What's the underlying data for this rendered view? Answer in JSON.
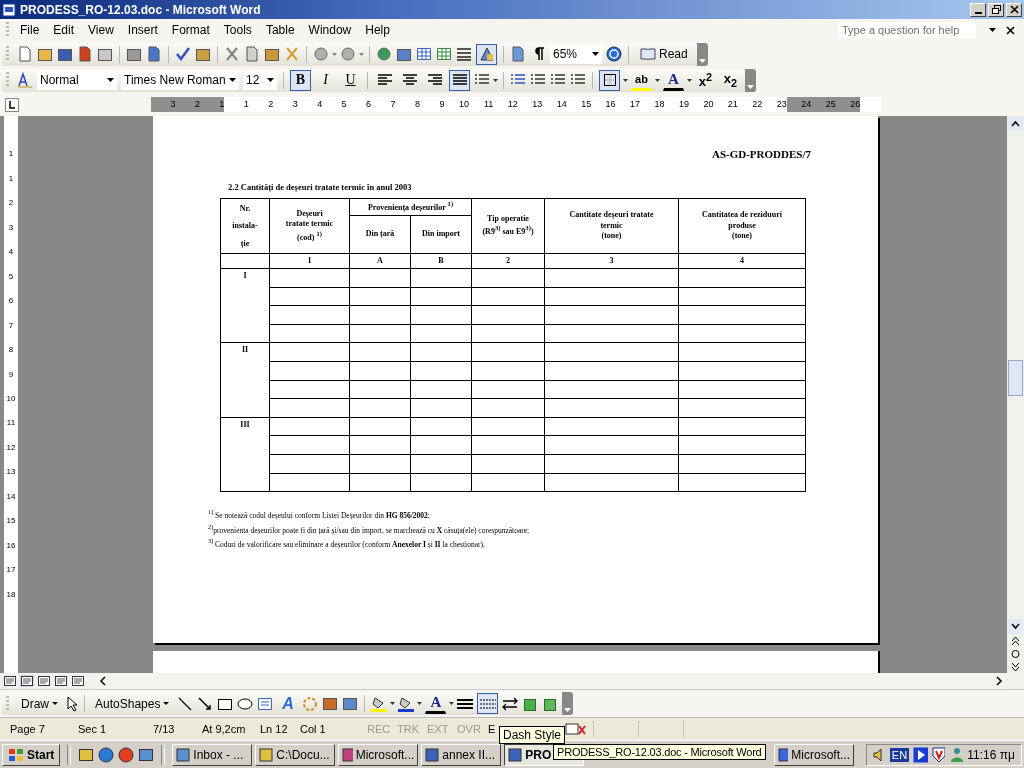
{
  "window": {
    "title": "PRODESS_RO-12.03.doc - Microsoft Word"
  },
  "menu": {
    "items": [
      "File",
      "Edit",
      "View",
      "Insert",
      "Format",
      "Tools",
      "Table",
      "Window",
      "Help"
    ],
    "help_box": {
      "placeholder": "Type a question for help"
    }
  },
  "standard_toolbar": {
    "drawing_selected": true,
    "zoom": "65%",
    "read": "Read"
  },
  "formatting_toolbar": {
    "style": "Normal",
    "font": "Times New Roman",
    "size": "12",
    "text_buttons": [
      {
        "label": "B",
        "selected": true
      },
      {
        "label": "I",
        "selected": false
      },
      {
        "label": "U",
        "selected": false
      }
    ],
    "alignments": [
      {
        "selected": false
      },
      {
        "selected": false
      },
      {
        "selected": false
      },
      {
        "selected": true
      }
    ],
    "highlight": "ab",
    "font_color": "A",
    "superscript": "x$^{2}$",
    "subscript": "x$_{2}$"
  },
  "ruler": {
    "numbers": [
      "3",
      "2",
      "1",
      "1",
      "2",
      "3",
      "4",
      "5",
      "6",
      "7",
      "8",
      "9",
      "10",
      "11",
      "12",
      "13",
      "14",
      "15",
      "16",
      "17",
      "18",
      "19",
      "20",
      "21",
      "22",
      "23",
      "24",
      "25",
      "26"
    ]
  },
  "vertical_ruler": {
    "numbers": [
      "1",
      "1",
      "2",
      "3",
      "4",
      "5",
      "6",
      "7",
      "8",
      "9",
      "10",
      "11",
      "12",
      "13",
      "14",
      "15",
      "16",
      "17",
      "18"
    ]
  },
  "document": {
    "header_code": "AS-GD-PRODDES/7",
    "section_title": "2.2 Cantități de deșeuri tratate termic în anul 2003",
    "table": {
      "col_nr": "Nr.\ninstala-\nție",
      "col_waste": "Deșeuri\ntratate termic\n(cod) $^{1)}$",
      "col_origin": "Proveniența deșeurilor $^{1)}$",
      "col_domestic": "Din țară",
      "col_import": "Din import",
      "col_operation": "Tip operatie\n(R9$^{3)}$ sau E9$^{3)}$)",
      "col_quantity": "Cantitate deșeuri tratate\ntermic\n(tone)",
      "col_residues": "Cantitatea de reziduuri\nproduse\n(tone)",
      "column_numbers": [
        "1",
        "A",
        "B",
        "2",
        "3",
        "4"
      ],
      "groups": [
        "I",
        "II",
        "III"
      ]
    },
    "footnotes": [
      "$^{1)}$ Se notează codul deșeului conform Listei Deșeurilor din **HG 856/2002**;",
      "$^{2)}$provenienta deșeurilor poate fi din țară și/sau din import, se marchează cu **X** căsuța(ele) corespunzătoare;",
      "$^{3)}$ Coduri de valorificare sau eliminare a deșeurilor (conform **Anexelor I** și **II** la chestionar)."
    ]
  },
  "drawing_toolbar": {
    "draw": "Draw",
    "autoshapes": "AutoShapes",
    "wordart": "A",
    "font_color": "A",
    "dash_style_selected": true
  },
  "status_bar": {
    "items": [
      {
        "text": "Page 7",
        "disabled": false
      },
      {
        "text": "Sec 1",
        "disabled": false
      },
      {
        "text": "7/13",
        "disabled": false
      },
      {
        "text": "At 9,2cm",
        "disabled": false
      },
      {
        "text": "Ln 12",
        "disabled": false
      },
      {
        "text": "Col 1",
        "disabled": false
      },
      {
        "text": "REC",
        "disabled": true
      },
      {
        "text": "TRK",
        "disabled": true
      },
      {
        "text": "EXT",
        "disabled": true
      },
      {
        "text": "OVR",
        "disabled": true
      },
      {
        "text": "E",
        "disabled": false
      }
    ],
    "tooltip": "Dash Style"
  },
  "taskbar": {
    "start": "Start",
    "tasks": [
      {
        "label": "Inbox - ...",
        "selected": false
      },
      {
        "label": "C:\\Docu...",
        "selected": false
      },
      {
        "label": "Microsoft...",
        "selected": false
      },
      {
        "label": "annex II...",
        "selected": false
      },
      {
        "label": "PRO",
        "selected": true
      },
      {
        "label": "Microsoft...",
        "selected": false
      }
    ],
    "tooltip": "PRODESS_RO-12.03.doc - Microsoft Word",
    "language": "EN",
    "clock": "11:16 πμ"
  }
}
